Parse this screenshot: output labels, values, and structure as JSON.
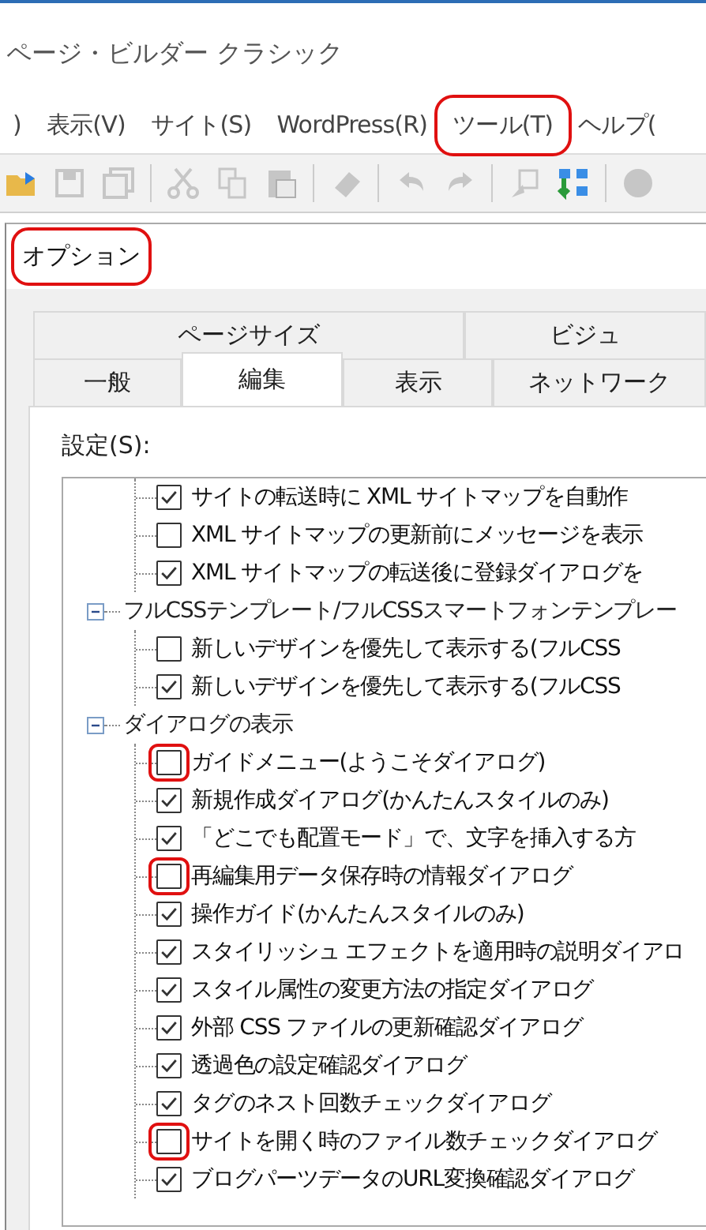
{
  "app": {
    "title": "ページ・ビルダー クラシック"
  },
  "menu": [
    {
      "label": ")",
      "highlighted": false
    },
    {
      "label": "表示(V)",
      "highlighted": false
    },
    {
      "label": "サイト(S)",
      "highlighted": false
    },
    {
      "label": "WordPress(R)",
      "highlighted": false
    },
    {
      "label": "ツール(T)",
      "highlighted": true
    },
    {
      "label": "ヘルプ(",
      "highlighted": false
    }
  ],
  "toolbar": [
    {
      "kind": "open",
      "disabled": false
    },
    {
      "kind": "save",
      "disabled": true
    },
    {
      "kind": "save-all",
      "disabled": true
    },
    {
      "kind": "separator"
    },
    {
      "kind": "cut",
      "disabled": true
    },
    {
      "kind": "copy",
      "disabled": true
    },
    {
      "kind": "paste",
      "disabled": true
    },
    {
      "kind": "separator"
    },
    {
      "kind": "eraser",
      "disabled": true
    },
    {
      "kind": "separator"
    },
    {
      "kind": "undo",
      "disabled": true
    },
    {
      "kind": "redo",
      "disabled": true
    },
    {
      "kind": "separator"
    },
    {
      "kind": "find",
      "disabled": true
    },
    {
      "kind": "sitemap",
      "disabled": false
    },
    {
      "kind": "separator"
    },
    {
      "kind": "partial",
      "disabled": true
    }
  ],
  "dialog": {
    "title": "オプション",
    "title_highlighted": true,
    "tab_rows": [
      [
        {
          "label": "ページサイズ",
          "selected": false
        },
        {
          "label": "ビジュ",
          "selected": false
        }
      ],
      [
        {
          "label": "一般",
          "selected": false
        },
        {
          "label": "編集",
          "selected": true
        },
        {
          "label": "表示",
          "selected": false
        },
        {
          "label": "ネットワーク",
          "selected": false
        }
      ]
    ],
    "settings_label": "設定(S):",
    "tree": [
      {
        "children": [
          {
            "label": "サイトの転送時に XML サイトマップを自動作",
            "checked": true,
            "highlighted": false
          },
          {
            "label": "XML サイトマップの更新前にメッセージを表示",
            "checked": false,
            "highlighted": false
          },
          {
            "label": "XML サイトマップの転送後に登録ダイアログを",
            "checked": true,
            "highlighted": false
          }
        ]
      },
      {
        "label": "フルCSSテンプレート/フルCSSスマートフォンテンプレー",
        "expanded": true,
        "children": [
          {
            "label": "新しいデザインを優先して表示する(フルCSS",
            "checked": false,
            "highlighted": false
          },
          {
            "label": "新しいデザインを優先して表示する(フルCSS",
            "checked": true,
            "highlighted": false
          }
        ]
      },
      {
        "label": "ダイアログの表示",
        "expanded": true,
        "children": [
          {
            "label": "ガイドメニュー(ようこそダイアログ)",
            "checked": false,
            "highlighted": true
          },
          {
            "label": "新規作成ダイアログ(かんたんスタイルのみ)",
            "checked": true,
            "highlighted": false
          },
          {
            "label": "「どこでも配置モード」で、文字を挿入する方",
            "checked": true,
            "highlighted": false
          },
          {
            "label": "再編集用データ保存時の情報ダイアログ",
            "checked": false,
            "highlighted": true
          },
          {
            "label": "操作ガイド(かんたんスタイルのみ)",
            "checked": true,
            "highlighted": false
          },
          {
            "label": "スタイリッシュ エフェクトを適用時の説明ダイアロ",
            "checked": true,
            "highlighted": false
          },
          {
            "label": "スタイル属性の変更方法の指定ダイアログ",
            "checked": true,
            "highlighted": false
          },
          {
            "label": "外部 CSS ファイルの更新確認ダイアログ",
            "checked": true,
            "highlighted": false
          },
          {
            "label": "透過色の設定確認ダイアログ",
            "checked": true,
            "highlighted": false
          },
          {
            "label": "タグのネスト回数チェックダイアログ",
            "checked": true,
            "highlighted": false
          },
          {
            "label": "サイトを開く時のファイル数チェックダイアログ",
            "checked": false,
            "highlighted": true
          },
          {
            "label": "ブログパーツデータのURL変換確認ダイアログ",
            "checked": true,
            "highlighted": false
          }
        ]
      }
    ]
  }
}
